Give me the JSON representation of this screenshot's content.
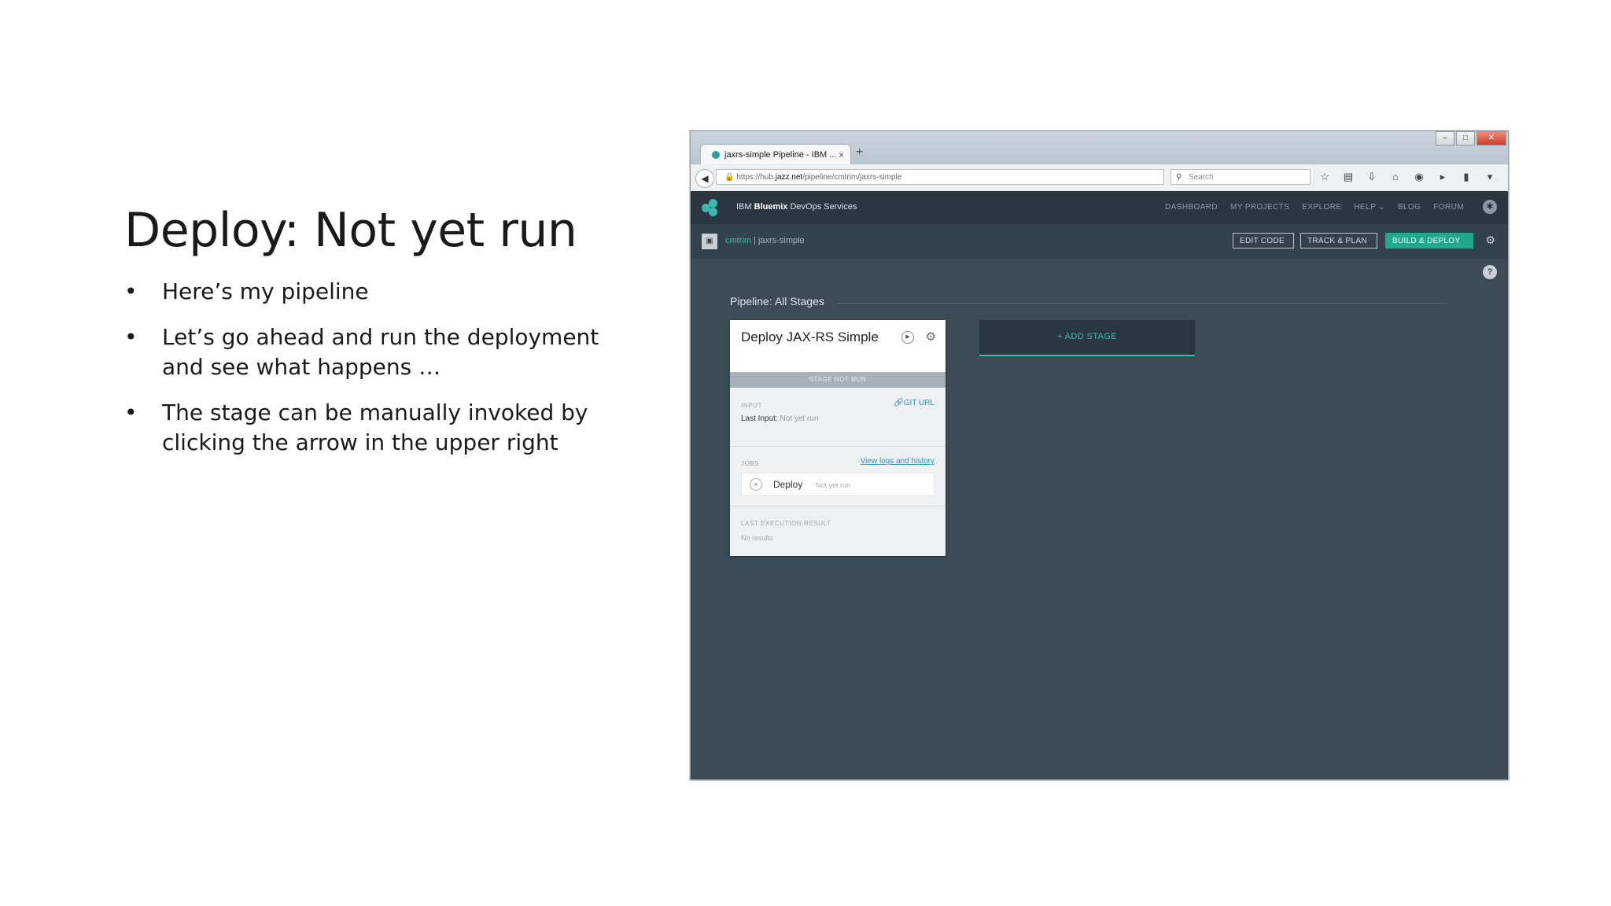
{
  "slide": {
    "title": "Deploy: Not yet run",
    "bullets": [
      "Here’s my pipeline",
      "Let’s go ahead and run the deployment and see what happens …",
      "The stage can be manually invoked by clicking the arrow in the upper right"
    ]
  },
  "browser": {
    "tab_title": "jaxrs-simple Pipeline - IBM ...",
    "url_prefix": "https://hub.",
    "url_host": "jazz.net",
    "url_path": "/pipeline/cmtrim/jaxrs-simple",
    "search_placeholder": "Search"
  },
  "app": {
    "brand_prefix": "IBM",
    "brand_name": "Bluemix",
    "brand_suffix": "DevOps Services",
    "nav": [
      "DASHBOARD",
      "MY PROJECTS",
      "EXPLORE",
      "HELP ⌄",
      "BLOG",
      "FORUM"
    ],
    "project_owner": "cmtrim",
    "project_name": "jaxrs-simple",
    "buttons": {
      "edit_code": "EDIT CODE",
      "track_plan": "TRACK & PLAN",
      "build_deploy": "BUILD & DEPLOY"
    }
  },
  "pipeline": {
    "heading": "Pipeline: All Stages",
    "add_stage": "+ ADD STAGE",
    "stage": {
      "title": "Deploy JAX-RS Simple",
      "status": "STAGE NOT RUN",
      "input_label": "INPUT",
      "git_url": "GIT URL",
      "last_input_label": "Last Input:",
      "last_input_value": "Not yet run",
      "jobs_label": "JOBS",
      "view_logs": "View logs and history",
      "job": {
        "name": "Deploy",
        "status": "Not yet run"
      },
      "last_result_label": "LAST EXECUTION RESULT",
      "last_result_value": "No results"
    }
  },
  "colors": {
    "accent": "#3fb6b0",
    "build_button": "#1fa88a",
    "pipeline_bg": "#3c4b55",
    "nav_bg": "#2a3740"
  }
}
